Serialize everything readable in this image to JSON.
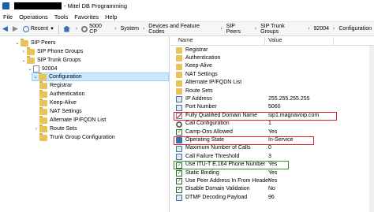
{
  "window": {
    "title": "- Mitel DB Programming"
  },
  "menu": [
    "File",
    "Operations",
    "Tools",
    "Favorites",
    "Help"
  ],
  "toolbar": {
    "recent_label": "Recent",
    "breadcrumbs": [
      "5000 CP",
      "System",
      "Devices and Feature Codes",
      "SIP Peers",
      "SIP Trunk Groups",
      "92004",
      "Configuration"
    ]
  },
  "tree": [
    {
      "label": "SIP Peers",
      "twisty": "v"
    },
    {
      "label": "SIP Phone Groups",
      "twisty": ">"
    },
    {
      "label": "SIP Trunk Groups",
      "twisty": "v"
    },
    {
      "label": "92004",
      "twisty": "v"
    },
    {
      "label": "Configuration",
      "twisty": "v"
    },
    {
      "label": "Registrar",
      "twisty": ""
    },
    {
      "label": "Authentication",
      "twisty": ""
    },
    {
      "label": "Keep-Alive",
      "twisty": ""
    },
    {
      "label": "NAT Settings",
      "twisty": ""
    },
    {
      "label": "Alternate IP/FQDN List",
      "twisty": ""
    },
    {
      "label": "Route Sets",
      "twisty": ">"
    },
    {
      "label": "Trunk Group Configuration",
      "twisty": ""
    }
  ],
  "table": {
    "headers": [
      "Name",
      "Value"
    ],
    "rows": [
      {
        "name": "Registrar",
        "value": "",
        "icon": "folder-icon"
      },
      {
        "name": "Authentication",
        "value": "",
        "icon": "folder-icon"
      },
      {
        "name": "Keep-Alive",
        "value": "",
        "icon": "folder-icon"
      },
      {
        "name": "NAT Settings",
        "value": "",
        "icon": "folder-icon"
      },
      {
        "name": "Alternate IP/FQDN List",
        "value": "",
        "icon": "folder-icon"
      },
      {
        "name": "Route Sets",
        "value": "",
        "icon": "folder-icon"
      },
      {
        "name": "IP Address",
        "value": "255.255.255.255",
        "icon": "number-icon"
      },
      {
        "name": "Port Number",
        "value": "5060",
        "icon": "number-icon"
      },
      {
        "name": "Fully Qualified Domain Name",
        "value": "sip1.magnavoip.com",
        "icon": "edit-icon"
      },
      {
        "name": "Call Configuration",
        "value": "1",
        "icon": "settings-icon"
      },
      {
        "name": "Camp-Ons Allowed",
        "value": "Yes",
        "icon": "checkbox-icon"
      },
      {
        "name": "Operating State",
        "value": "In-Service",
        "icon": "state-icon"
      },
      {
        "name": "Maximum Number of Calls",
        "value": "0",
        "icon": "number-icon"
      },
      {
        "name": "Call Failure Threshold",
        "value": "3",
        "icon": "number-icon"
      },
      {
        "name": "Use ITU-T E.164 Phone Number",
        "value": "Yes",
        "icon": "checkbox-icon"
      },
      {
        "name": "Static Binding",
        "value": "Yes",
        "icon": "checkbox-icon"
      },
      {
        "name": "Use Peer Address In From Header",
        "value": "Yes",
        "icon": "checkbox-icon"
      },
      {
        "name": "Disable Domain Validation",
        "value": "No",
        "icon": "checkbox-icon"
      },
      {
        "name": "DTMF Decoding Payload",
        "value": "96",
        "icon": "number-icon"
      }
    ]
  },
  "colors": {
    "highlight_red": "#d9232d",
    "highlight_green": "#3a8f2e",
    "selection": "#cce8ff"
  }
}
